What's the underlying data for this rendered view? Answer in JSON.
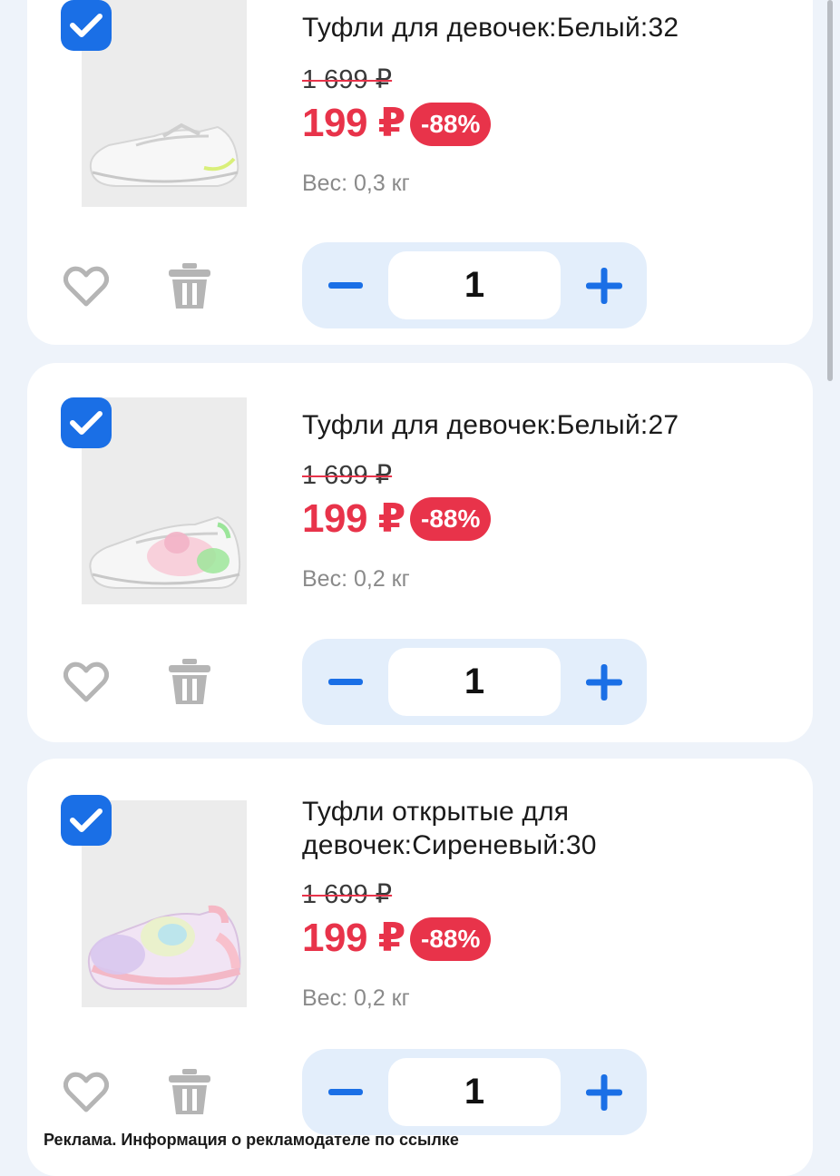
{
  "items": [
    {
      "title": "Туфли для девочек:Белый:32",
      "old_price": "1 699 ₽",
      "price": "199 ₽",
      "discount": "-88%",
      "weight": "Вес: 0,3 кг",
      "quantity": "1",
      "selected": true
    },
    {
      "title": "Туфли для девочек:Белый:27",
      "old_price": "1 699 ₽",
      "price": "199 ₽",
      "discount": "-88%",
      "weight": "Вес: 0,2 кг",
      "quantity": "1",
      "selected": true
    },
    {
      "title": "Туфли открытые для девочек:Сиреневый:30",
      "old_price": "1 699 ₽",
      "price": "199 ₽",
      "discount": "-88%",
      "weight": "Вес: 0,2 кг",
      "quantity": "1",
      "selected": true
    }
  ],
  "ad_notice": "Реклама. Информация о рекламодателе по ссылке",
  "icons": {
    "checkbox": "check-icon",
    "favorite": "heart-icon",
    "delete": "trash-icon",
    "decrease": "minus-icon",
    "increase": "plus-icon"
  },
  "colors": {
    "accent": "#1a6fe6",
    "price": "#e8334a",
    "stepper_bg": "#e3eefb",
    "page_bg": "#eef3fa"
  }
}
